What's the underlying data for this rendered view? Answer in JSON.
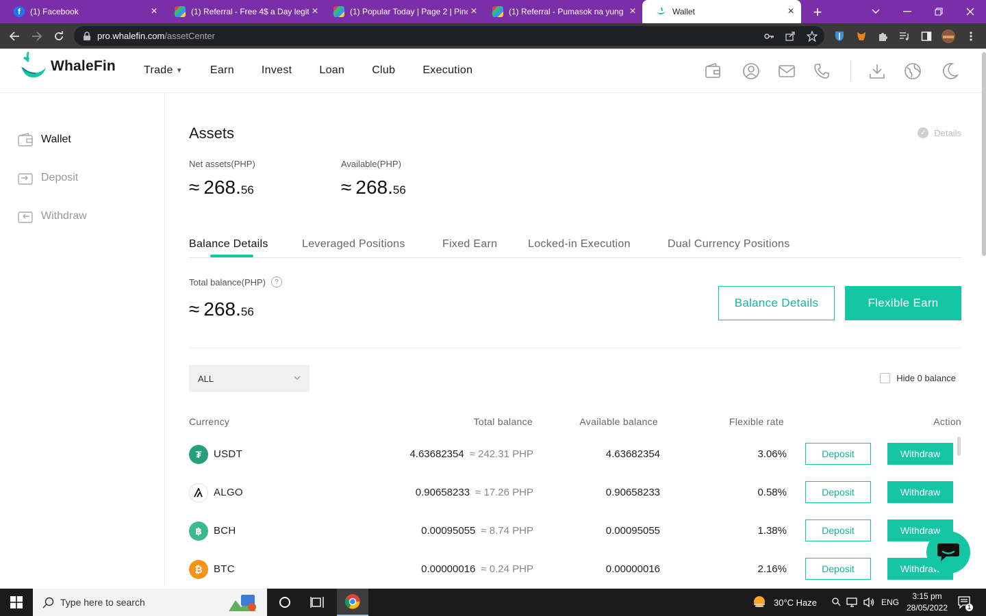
{
  "browser": {
    "tabs": [
      {
        "title": "(1) Facebook",
        "favicon": "facebook-icon",
        "color": "#1877f2"
      },
      {
        "title": "(1) Referral - Free 4$ a Day legit -",
        "favicon": "pinwheel-icon",
        "color": "#6ea8d8"
      },
      {
        "title": "(1) Popular Today | Page 2 | Pinoy",
        "favicon": "pinwheel-icon",
        "color": "#6ea8d8"
      },
      {
        "title": "(1) Referral - Pumasok na yung",
        "favicon": "pinwheel-icon",
        "color": "#6ea8d8"
      },
      {
        "title": "Wallet",
        "favicon": "whalefin-icon",
        "color": "#14c6a4"
      }
    ],
    "url_domain": "pro.whalefin.com",
    "url_path": "/assetCenter"
  },
  "site": {
    "brand": "WhaleFin",
    "accent": "#14c6a4",
    "nav": [
      "Trade",
      "Earn",
      "Invest",
      "Loan",
      "Club",
      "Execution"
    ]
  },
  "sidebar": {
    "items": [
      {
        "label": "Wallet",
        "icon": "wallet-icon"
      },
      {
        "label": "Deposit",
        "icon": "deposit-icon"
      },
      {
        "label": "Withdraw",
        "icon": "withdraw-icon"
      }
    ]
  },
  "assets": {
    "title": "Assets",
    "details_link": "Details",
    "net_label": "Net assets(PHP)",
    "net_int": "268.",
    "net_dec": "56",
    "available_label": "Available(PHP)",
    "available_int": "268.",
    "available_dec": "56",
    "approx": "≈"
  },
  "tabs": [
    "Balance Details",
    "Leveraged Positions",
    "Fixed Earn",
    "Locked-in Execution",
    "Dual Currency Positions"
  ],
  "balance": {
    "total_label": "Total balance(PHP)",
    "help": "?",
    "total_int": "268.",
    "total_dec": "56",
    "btn_details": "Balance Details",
    "btn_flexible": "Flexible Earn"
  },
  "filter": {
    "select_value": "ALL",
    "hide_zero_label": "Hide 0 balance"
  },
  "table": {
    "headers": [
      "Currency",
      "Total balance",
      "Available balance",
      "Flexible rate",
      "Action"
    ],
    "rows": [
      {
        "symbol": "USDT",
        "glyph": "₮",
        "color": "#26a17b",
        "total": "4.63682354",
        "conv": "≈ 242.31 PHP",
        "available": "4.63682354",
        "rate": "3.06%",
        "deposit": "Deposit",
        "withdraw": "Withdraw"
      },
      {
        "symbol": "ALGO",
        "glyph": "A",
        "color": "#ffffff",
        "total": "0.90658233",
        "conv": "≈ 17.26 PHP",
        "available": "0.90658233",
        "rate": "0.58%",
        "deposit": "Deposit",
        "withdraw": "Withdraw"
      },
      {
        "symbol": "BCH",
        "glyph": "฿",
        "color": "#3cb98c",
        "total": "0.00095055",
        "conv": "≈ 8.74 PHP",
        "available": "0.00095055",
        "rate": "1.38%",
        "deposit": "Deposit",
        "withdraw": "Withdraw"
      },
      {
        "symbol": "BTC",
        "glyph": "₿",
        "color": "#f7931a",
        "total": "0.00000016",
        "conv": "≈ 0.24 PHP",
        "available": "0.00000016",
        "rate": "2.16%",
        "deposit": "Deposit",
        "withdraw": "Withdraw"
      }
    ]
  },
  "taskbar": {
    "search_placeholder": "Type here to search",
    "weather": "30°C  Haze",
    "lang": "ENG",
    "time": "3:15 pm",
    "date": "28/05/2022",
    "notif_count": "1"
  }
}
